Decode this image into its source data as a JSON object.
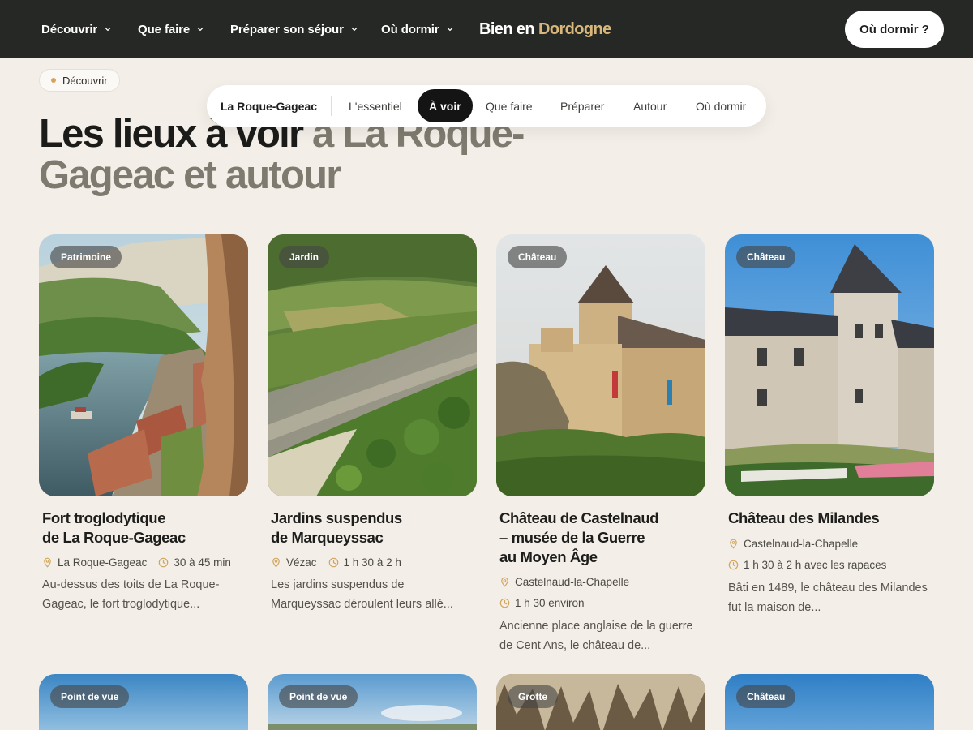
{
  "topnav": {
    "items": [
      {
        "label": "Découvrir"
      },
      {
        "label": "Que faire"
      },
      {
        "label": "Préparer son séjour"
      },
      {
        "label": "Où dormir"
      }
    ],
    "brand_part1": "Bien en",
    "brand_part2": "Dordogne",
    "cta_label": "Où dormir ?"
  },
  "breadcrumb": {
    "label": "Découvrir"
  },
  "heading": {
    "dark": "Les lieux à voir",
    "muted": "à La Roque-Gageac et autour"
  },
  "subnav": {
    "place": "La Roque-Gageac",
    "tabs": [
      {
        "label": "L'essentiel"
      },
      {
        "label": "À voir"
      },
      {
        "label": "Que faire"
      },
      {
        "label": "Préparer"
      },
      {
        "label": "Autour"
      },
      {
        "label": "Où dormir"
      }
    ],
    "active_tab": "À voir"
  },
  "cards": [
    {
      "badge": "Patrimoine",
      "title_line1": "Fort troglodytique",
      "title_line2": "de La Roque-Gageac",
      "location": "La Roque-Gageac",
      "duration": "30 à 45 min",
      "description": "Au-dessus des toits de La Roque-Gageac, le fort troglodytique..."
    },
    {
      "badge": "Jardin",
      "title_line1": "Jardins suspendus",
      "title_line2": "de Marqueyssac",
      "location": "Vézac",
      "duration": "1 h 30 à 2 h",
      "description": "Les jardins suspendus de Marqueyssac déroulent leurs allé..."
    },
    {
      "badge": "Château",
      "title_line1": "Château de Castelnaud",
      "title_line2": "– musée de la Guerre",
      "title_line3": "au Moyen Âge",
      "location": "Castelnaud-la-Chapelle",
      "duration": "1 h 30 environ",
      "description": "Ancienne place anglaise de la guerre de Cent Ans, le château de..."
    },
    {
      "badge": "Château",
      "title_line1": "Château des Milandes",
      "location": "Castelnaud-la-Chapelle",
      "duration": "1 h 30 à 2 h avec les rapaces",
      "description": "Bâti en 1489, le château des Milandes fut la maison de..."
    }
  ],
  "next_row_badges": [
    "Point de vue",
    "Point de vue",
    "Grotte",
    "Château"
  ],
  "icons": {
    "location": "map-pin-icon",
    "duration": "clock-icon",
    "dropdown": "chevron-down-icon"
  },
  "colors": {
    "topbar": "#252824",
    "page_background": "#f3eee7",
    "brand_accent": "#d9b77a",
    "meta_icon": "#d2a65e",
    "active_tab": "#141414"
  }
}
